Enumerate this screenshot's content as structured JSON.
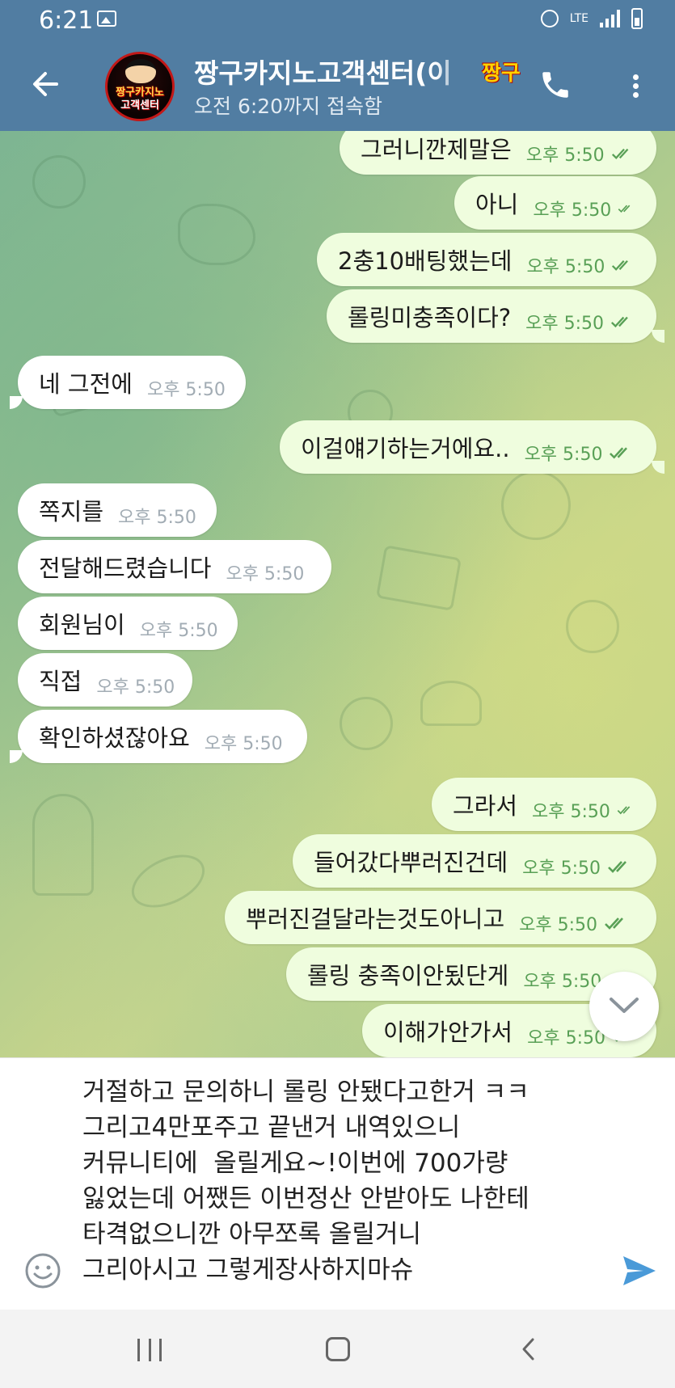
{
  "status_bar": {
    "time": "6:21",
    "network": "LTE"
  },
  "header": {
    "title": "짱구카지노고객센터(이",
    "title_badge": "짱구",
    "subtitle": "오전 6:20까지 접속함",
    "avatar_line1": "짱구카지노",
    "avatar_line2": "고객센터"
  },
  "messages": [
    {
      "dir": "out",
      "text": "그러니깐제말은",
      "time": "오후 5:50"
    },
    {
      "dir": "out",
      "text": "아니",
      "time": "오후 5:50"
    },
    {
      "dir": "out",
      "text": "2충10배팅했는데",
      "time": "오후 5:50"
    },
    {
      "dir": "out",
      "text": "롤링미충족이다?",
      "time": "오후 5:50"
    },
    {
      "dir": "in",
      "text": "네 그전에",
      "time": "오후 5:50"
    },
    {
      "dir": "out",
      "text": "이걸얘기하는거에요..",
      "time": "오후 5:50"
    },
    {
      "dir": "in",
      "text": "쪽지를",
      "time": "오후 5:50"
    },
    {
      "dir": "in",
      "text": "전달해드렸습니다",
      "time": "오후 5:50"
    },
    {
      "dir": "in",
      "text": "회원님이",
      "time": "오후 5:50"
    },
    {
      "dir": "in",
      "text": "직접",
      "time": "오후 5:50"
    },
    {
      "dir": "in",
      "text": "확인하셨잖아요",
      "time": "오후 5:50"
    },
    {
      "dir": "out",
      "text": "그라서",
      "time": "오후 5:50"
    },
    {
      "dir": "out",
      "text": "들어갔다뿌러진건데",
      "time": "오후 5:50"
    },
    {
      "dir": "out",
      "text": "뿌러진걸달라는것도아니고",
      "time": "오후 5:50"
    },
    {
      "dir": "out",
      "text": "롤링 충족이안됬단게",
      "time": "오후 5:50"
    },
    {
      "dir": "out",
      "text": "이해가안가서",
      "time": "오후 5:50"
    }
  ],
  "composer": {
    "draft": "거절하고 문의하니 롤링 안됐다고한거 ㅋㅋ\n그리고4만포주고 끝낸거 내역있으니\n커뮤니티에  올릴게요~!이번에 700가량\n잃었는데 어쨌든 이번정산 안받아도 나한테\n타격없으니깐 아무쪼록 올릴거니\n그리아시고 그렇게장사하지마슈"
  },
  "colors": {
    "header_bg": "#517da2",
    "outgoing_bubble": "#effdde",
    "incoming_bubble": "#ffffff",
    "outgoing_time": "#59a056",
    "send_icon": "#4a9ad8"
  },
  "icons": {
    "back": "arrow-left-icon",
    "call": "phone-icon",
    "more": "more-vertical-icon",
    "emoji": "smiley-icon",
    "send": "send-icon",
    "scroll": "chevron-down-icon"
  }
}
